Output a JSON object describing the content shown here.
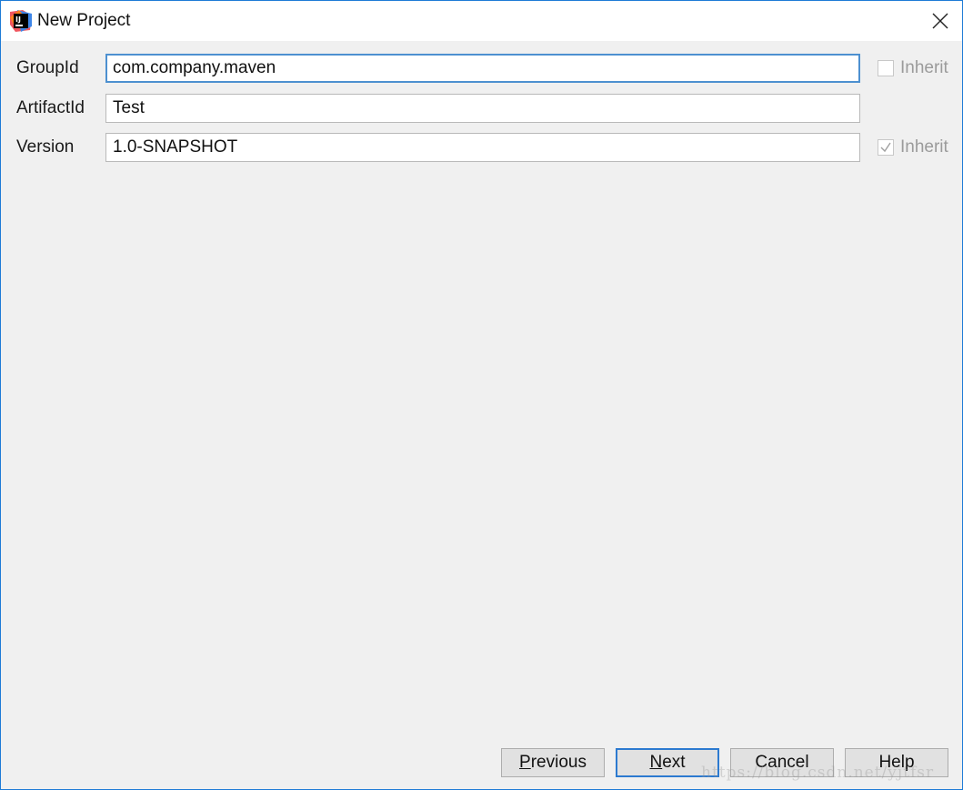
{
  "window": {
    "title": "New Project",
    "app_icon_text": "IJ",
    "accent_color": "#1e7bd6"
  },
  "form": {
    "group_id": {
      "label": "GroupId",
      "value": "com.company.maven",
      "inherit_label": "Inherit",
      "inherit_checked": false
    },
    "artifact_id": {
      "label": "ArtifactId",
      "value": "Test"
    },
    "version": {
      "label": "Version",
      "value": "1.0-SNAPSHOT",
      "inherit_label": "Inherit",
      "inherit_checked": true
    }
  },
  "buttons": {
    "previous": {
      "mnemonic": "P",
      "rest": "revious"
    },
    "next": {
      "mnemonic": "N",
      "rest": "ext"
    },
    "cancel": {
      "label": "Cancel"
    },
    "help": {
      "label": "Help"
    }
  },
  "watermark": "https://blog.csdn.net/yjtfsr"
}
